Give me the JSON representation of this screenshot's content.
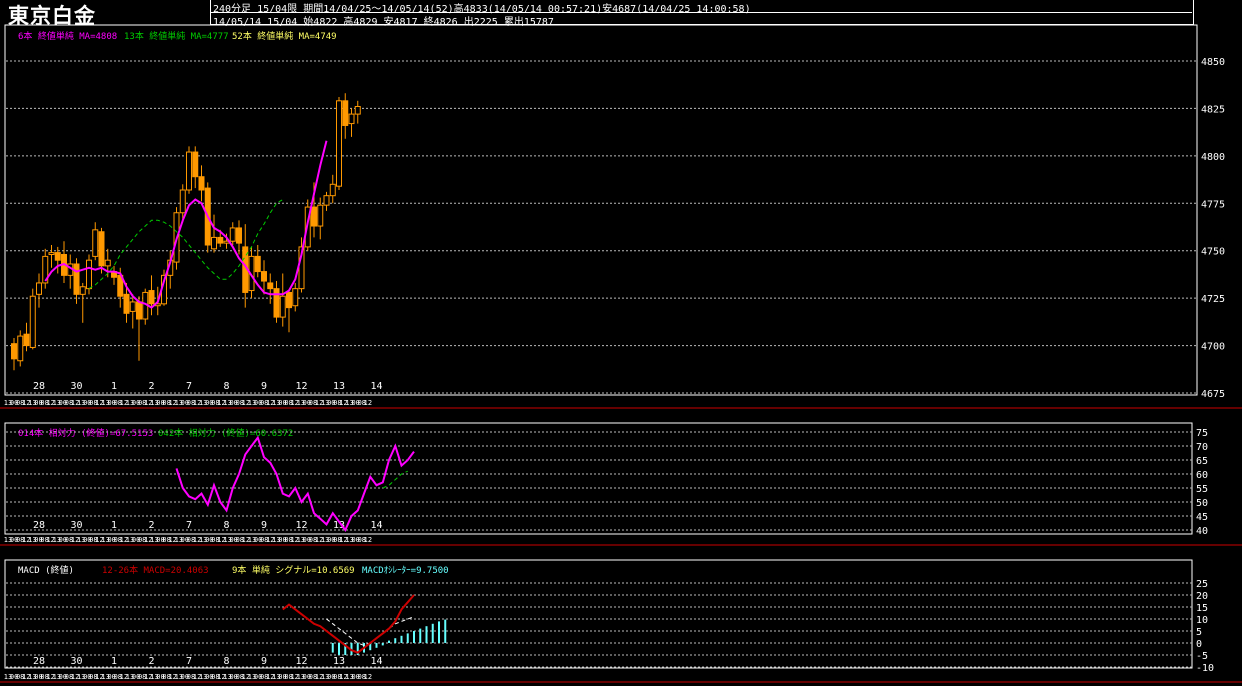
{
  "header": {
    "title": "東京白金",
    "period_label": "240分足",
    "contract": "15/04限",
    "range": "期間14/04/25～14/05/14(52)高4833(14/05/14 00:57:21)安4687(14/04/25 14:00:58)",
    "ohlc": "14/05/14 15/04 始4822 高4829 安4817 終4826 出2225 累出15787"
  },
  "legend": {
    "ma1": "6本 終値単純 MA=4808",
    "ma2": "13本 終値単純 MA=4777",
    "ma3": "52本 終値単純 MA=4749",
    "rsi1": "014本 相対力 (終値)=67.5153",
    "rsi2": "042本 相対力 (終値)=60.6372",
    "macd_title": "MACD (終値)",
    "macd1": "12-26本 MACD=20.4063",
    "macd2": "9本 単純 シグナル=10.6569",
    "macd3": "MACDｵｼﾚｰﾀｰ=9.7500"
  },
  "colors": {
    "candle": "#ff9900",
    "ma_short": "#ff00ff",
    "ma_mid": "#00cc00",
    "ma_long": "#ffff66",
    "rsi14": "#ff00ff",
    "rsi42": "#00cc00",
    "macd": "#cc0000",
    "signal": "#ffffff",
    "osc": "#66ffff",
    "frame": "#ffffff",
    "separator": "#cc0000"
  },
  "chart_data": [
    {
      "type": "candlestick",
      "title": "東京白金 240分足",
      "ylim": [
        4675,
        4860
      ],
      "yticks": [
        4675,
        4700,
        4725,
        4750,
        4775,
        4800,
        4825,
        4850
      ],
      "day_labels": [
        {
          "label": "28",
          "i": 4
        },
        {
          "label": "30",
          "i": 10
        },
        {
          "label": "1",
          "i": 16
        },
        {
          "label": "2",
          "i": 22
        },
        {
          "label": "7",
          "i": 28
        },
        {
          "label": "8",
          "i": 34
        },
        {
          "label": "9",
          "i": 40
        },
        {
          "label": "12",
          "i": 46
        },
        {
          "label": "13",
          "i": 52
        },
        {
          "label": "14",
          "i": 58
        }
      ],
      "time_ticks": [
        "13",
        "00",
        "08",
        "12",
        "13",
        "00",
        "08",
        "12"
      ],
      "candles": [
        [
          4701,
          4704,
          4687,
          4693
        ],
        [
          4692,
          4708,
          4689,
          4705
        ],
        [
          4706,
          4712,
          4697,
          4700
        ],
        [
          4699,
          4730,
          4698,
          4726
        ],
        [
          4727,
          4738,
          4720,
          4733
        ],
        [
          4733,
          4751,
          4730,
          4747
        ],
        [
          4748,
          4753,
          4741,
          4749
        ],
        [
          4749,
          4752,
          4738,
          4745
        ],
        [
          4748,
          4755,
          4733,
          4737
        ],
        [
          4737,
          4748,
          4730,
          4743
        ],
        [
          4743,
          4746,
          4722,
          4727
        ],
        [
          4727,
          4733,
          4712,
          4731
        ],
        [
          4730,
          4748,
          4727,
          4745
        ],
        [
          4747,
          4765,
          4745,
          4761
        ],
        [
          4760,
          4762,
          4738,
          4742
        ],
        [
          4742,
          4751,
          4736,
          4745
        ],
        [
          4739,
          4742,
          4732,
          4736
        ],
        [
          4737,
          4741,
          4720,
          4726
        ],
        [
          4727,
          4733,
          4712,
          4717
        ],
        [
          4718,
          4727,
          4709,
          4723
        ],
        [
          4723,
          4726,
          4692,
          4714
        ],
        [
          4714,
          4730,
          4711,
          4728
        ],
        [
          4729,
          4737,
          4716,
          4722
        ],
        [
          4721,
          4731,
          4716,
          4722
        ],
        [
          4722,
          4740,
          4721,
          4737
        ],
        [
          4737,
          4750,
          4730,
          4745
        ],
        [
          4744,
          4773,
          4740,
          4770
        ],
        [
          4770,
          4785,
          4765,
          4782
        ],
        [
          4782,
          4805,
          4780,
          4802
        ],
        [
          4802,
          4805,
          4783,
          4789
        ],
        [
          4789,
          4795,
          4776,
          4782
        ],
        [
          4783,
          4786,
          4749,
          4753
        ],
        [
          4751,
          4769,
          4749,
          4757
        ],
        [
          4757,
          4761,
          4752,
          4754
        ],
        [
          4754,
          4759,
          4751,
          4755
        ],
        [
          4755,
          4765,
          4753,
          4762
        ],
        [
          4762,
          4766,
          4748,
          4754
        ],
        [
          4752,
          4764,
          4720,
          4728
        ],
        [
          4729,
          4752,
          4725,
          4747
        ],
        [
          4747,
          4753,
          4736,
          4739
        ],
        [
          4739,
          4745,
          4727,
          4734
        ],
        [
          4733,
          4738,
          4722,
          4730
        ],
        [
          4730,
          4734,
          4712,
          4715
        ],
        [
          4715,
          4738,
          4710,
          4726
        ],
        [
          4728,
          4729,
          4707,
          4720
        ],
        [
          4721,
          4733,
          4718,
          4730
        ],
        [
          4730,
          4757,
          4728,
          4752
        ],
        [
          4752,
          4777,
          4750,
          4773
        ],
        [
          4773,
          4786,
          4757,
          4763
        ],
        [
          4763,
          4778,
          4756,
          4774
        ],
        [
          4774,
          4781,
          4771,
          4779
        ],
        [
          4779,
          4790,
          4775,
          4785
        ],
        [
          4784,
          4831,
          4782,
          4829
        ],
        [
          4829,
          4833,
          4809,
          4816
        ],
        [
          4817,
          4825,
          4810,
          4822
        ],
        [
          4822,
          4829,
          4817,
          4826
        ]
      ],
      "series": [
        {
          "name": "6本 終値単純 MA",
          "style": "solid",
          "start": 5,
          "values": [
            4734,
            4739,
            4742,
            4743,
            4741,
            4739,
            4740,
            4741,
            4740,
            4741,
            4739,
            4739,
            4738,
            4731,
            4726,
            4723,
            4722,
            4720,
            4723,
            4734,
            4744,
            4756,
            4766,
            4774,
            4777,
            4775,
            4768,
            4762,
            4760,
            4757,
            4752,
            4746,
            4742,
            4737,
            4732,
            4728,
            4727,
            4727,
            4727,
            4729,
            4735,
            4748,
            4765,
            4780,
            4795,
            4808
          ]
        },
        {
          "name": "13本 終値単純 MA",
          "style": "dashed",
          "start": 12,
          "values": [
            4730,
            4732,
            4735,
            4738,
            4742,
            4748,
            4752,
            4756,
            4760,
            4763,
            4766,
            4766,
            4765,
            4763,
            4760,
            4757,
            4753,
            4749,
            4745,
            4741,
            4738,
            4735,
            4735,
            4738,
            4742,
            4747,
            4752,
            4759,
            4764,
            4770,
            4775,
            4777
          ]
        }
      ]
    },
    {
      "type": "line",
      "title": "相対力 (終値)",
      "ylim": [
        40,
        75
      ],
      "yticks": [
        40,
        45,
        50,
        55,
        60,
        65,
        70,
        75
      ],
      "series": [
        {
          "name": "014本 相対力 (終値)",
          "style": "solid",
          "start": 26,
          "values": [
            62,
            55,
            52,
            51,
            53,
            49,
            56,
            50,
            47,
            55,
            60,
            67,
            70,
            73,
            66,
            64,
            60,
            53,
            52,
            55,
            50,
            53,
            46,
            44,
            42,
            46,
            43,
            40,
            45,
            47,
            53,
            59,
            56,
            57,
            65,
            70,
            63,
            65,
            68
          ]
        },
        {
          "name": "042本 相対力 (終値)",
          "style": "dashed",
          "start": 59,
          "values": [
            55,
            56,
            58,
            60,
            61
          ]
        }
      ]
    },
    {
      "type": "line",
      "title": "MACD (終値)",
      "ylim": [
        -10,
        25
      ],
      "yticks": [
        -10,
        -5,
        0,
        5,
        10,
        15,
        20,
        25
      ],
      "series": [
        {
          "name": "12-26本 MACD",
          "style": "solid",
          "start": 43,
          "values": [
            14,
            16,
            14,
            12,
            10,
            8,
            7,
            5,
            3,
            1,
            -1,
            -3,
            -4,
            -2,
            0,
            2,
            4,
            6,
            9,
            14,
            17,
            20
          ]
        },
        {
          "name": "9本 単純 シグナル",
          "style": "dashed",
          "start": 50,
          "values": [
            10,
            8,
            6,
            4,
            2,
            0,
            -1,
            0,
            2,
            4,
            6,
            8,
            9,
            10,
            11
          ]
        },
        {
          "name": "MACDｵｼﾚｰﾀｰ",
          "style": "bar",
          "start": 51,
          "values": [
            -4,
            -5,
            -5,
            -5,
            -5,
            -4,
            -3,
            -2,
            -1,
            1,
            2,
            3,
            4,
            5,
            6,
            7,
            8,
            9,
            9.75
          ]
        }
      ]
    }
  ]
}
